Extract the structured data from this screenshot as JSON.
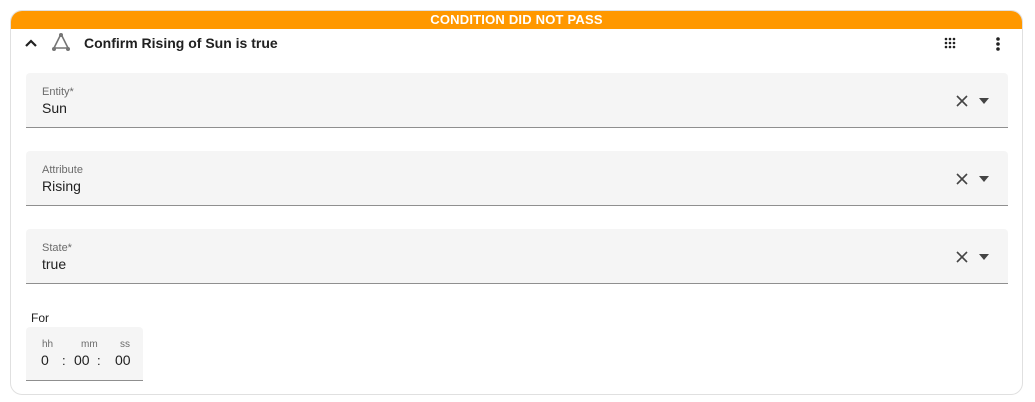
{
  "banner": {
    "text": "CONDITION DID NOT PASS"
  },
  "header": {
    "title": "Confirm Rising of Sun is true",
    "icons": [
      "chevron-up-icon",
      "condition-icon",
      "drag-grid-icon",
      "more-vert-icon"
    ]
  },
  "fields": [
    {
      "label": "Entity*",
      "value": "Sun"
    },
    {
      "label": "Attribute",
      "value": "Rising"
    },
    {
      "label": "State*",
      "value": "true"
    }
  ],
  "duration": {
    "label": "For",
    "hh_label": "hh",
    "mm_label": "mm",
    "ss_label": "ss",
    "hh": "0",
    "mm": "00",
    "ss": "00",
    "separator": ":"
  },
  "colors": {
    "banner": "#ff9800",
    "field_bg": "#f5f5f5",
    "text": "#212121"
  }
}
